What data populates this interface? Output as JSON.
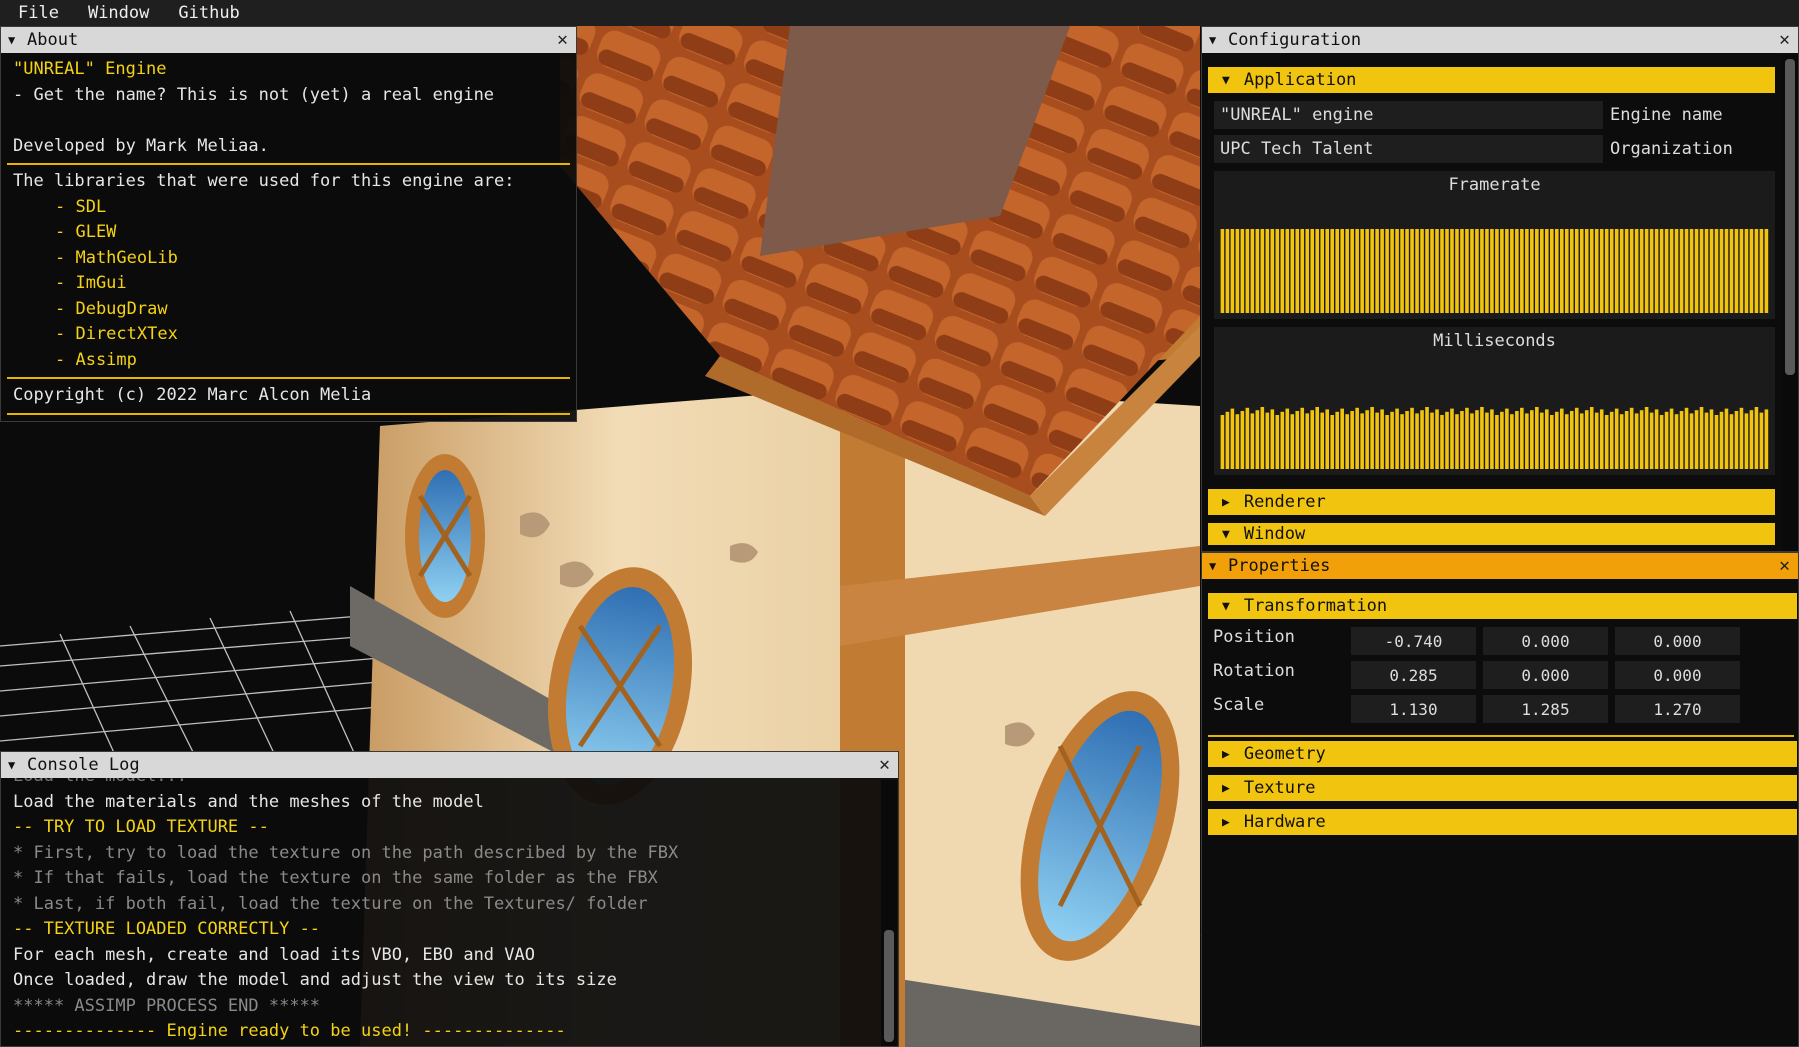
{
  "menu": [
    "File",
    "Window",
    "Github"
  ],
  "about": {
    "title": "About",
    "name": "\"UNREAL\" Engine",
    "tagline": "- Get the name? This is not (yet) a real engine",
    "developer": "Developed by Mark Meliaa.",
    "libraries_intro": "The libraries that were used for this engine are:",
    "libraries": [
      "- SDL",
      "- GLEW",
      "- MathGeoLib",
      "- ImGui",
      "- DebugDraw",
      "- DirectXTex",
      "- Assimp"
    ],
    "copyright": "Copyright (c) 2022 Marc Alcon Melia"
  },
  "configuration": {
    "title": "Configuration",
    "sections": {
      "application": "Application",
      "renderer": "Renderer",
      "window": "Window"
    },
    "engine_name_value": "\"UNREAL\" engine",
    "engine_name_label": "Engine name",
    "organization_value": "UPC Tech Talent",
    "organization_label": "Organization",
    "framerate_title": "Framerate",
    "milliseconds_title": "Milliseconds",
    "accent": "#f1c40f"
  },
  "properties": {
    "title": "Properties",
    "transformation": "Transformation",
    "rows": [
      {
        "label": "Position",
        "values": [
          "-0.740",
          "0.000",
          "0.000"
        ]
      },
      {
        "label": "Rotation",
        "values": [
          "0.285",
          "0.000",
          "0.000"
        ]
      },
      {
        "label": "Scale",
        "values": [
          "1.130",
          "1.285",
          "1.270"
        ]
      }
    ],
    "collapsed": [
      "Geometry",
      "Texture",
      "Hardware"
    ]
  },
  "console": {
    "title": "Console Log",
    "lines": [
      {
        "text": "Load the materials and the meshes of the model",
        "style": "white"
      },
      {
        "text": "-- TRY TO LOAD TEXTURE --",
        "style": "yellow"
      },
      {
        "text": "* First, try to load the texture on the path described by the FBX",
        "style": "gray"
      },
      {
        "text": "* If that fails, load the texture on the same folder as the FBX",
        "style": "gray"
      },
      {
        "text": "* Last, if both fail, load the texture on the Textures/ folder",
        "style": "gray"
      },
      {
        "text": "-- TEXTURE LOADED CORRECTLY --",
        "style": "yellow"
      },
      {
        "text": "For each mesh, create and load its VBO, EBO and VAO",
        "style": "white"
      },
      {
        "text": "Once loaded, draw the model and adjust the view to its size",
        "style": "white"
      },
      {
        "text": "***** ASSIMP PROCESS END *****",
        "style": "gray"
      },
      {
        "text": "-------------- Engine ready to be used! --------------",
        "style": "yellow"
      }
    ]
  }
}
